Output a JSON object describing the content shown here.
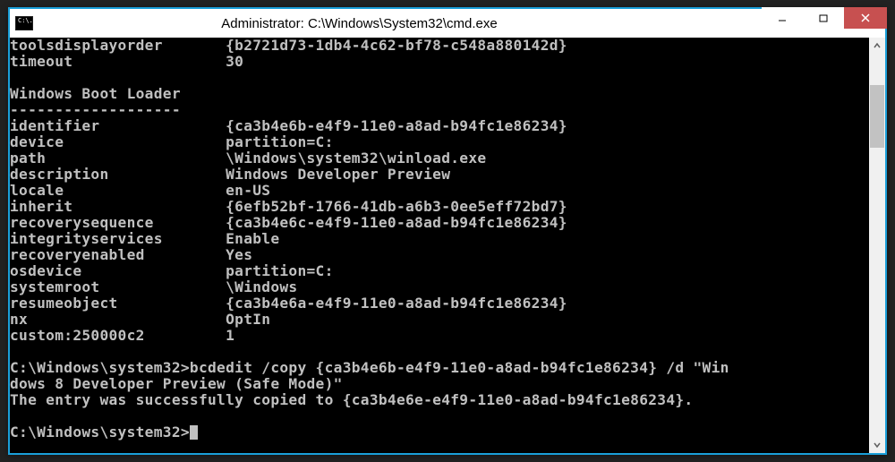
{
  "window": {
    "title": "Administrator: C:\\Windows\\System32\\cmd.exe",
    "sysicon_text": "C:\\."
  },
  "output": {
    "header_kv": {
      "toolsdisplayorder": "{b2721d73-1db4-4c62-bf78-c548a880142d}",
      "timeout": "30"
    },
    "section_title": "Windows Boot Loader",
    "section_underline": "-------------------",
    "entries": {
      "identifier": "{ca3b4e6b-e4f9-11e0-a8ad-b94fc1e86234}",
      "device": "partition=C:",
      "path": "\\Windows\\system32\\winload.exe",
      "description": "Windows Developer Preview",
      "locale": "en-US",
      "inherit": "{6efb52bf-1766-41db-a6b3-0ee5eff72bd7}",
      "recoverysequence": "{ca3b4e6c-e4f9-11e0-a8ad-b94fc1e86234}",
      "integrityservices": "Enable",
      "recoveryenabled": "Yes",
      "osdevice": "partition=C:",
      "systemroot": "\\Windows",
      "resumeobject": "{ca3b4e6a-e4f9-11e0-a8ad-b94fc1e86234}",
      "nx": "OptIn",
      "custom:250000c2": "1"
    },
    "command_lines": [
      "C:\\Windows\\system32>bcdedit /copy {ca3b4e6b-e4f9-11e0-a8ad-b94fc1e86234} /d \"Win",
      "dows 8 Developer Preview (Safe Mode)\""
    ],
    "result_line": "The entry was successfully copied to {ca3b4e6e-e4f9-11e0-a8ad-b94fc1e86234}.",
    "prompt": "C:\\Windows\\system32>"
  }
}
